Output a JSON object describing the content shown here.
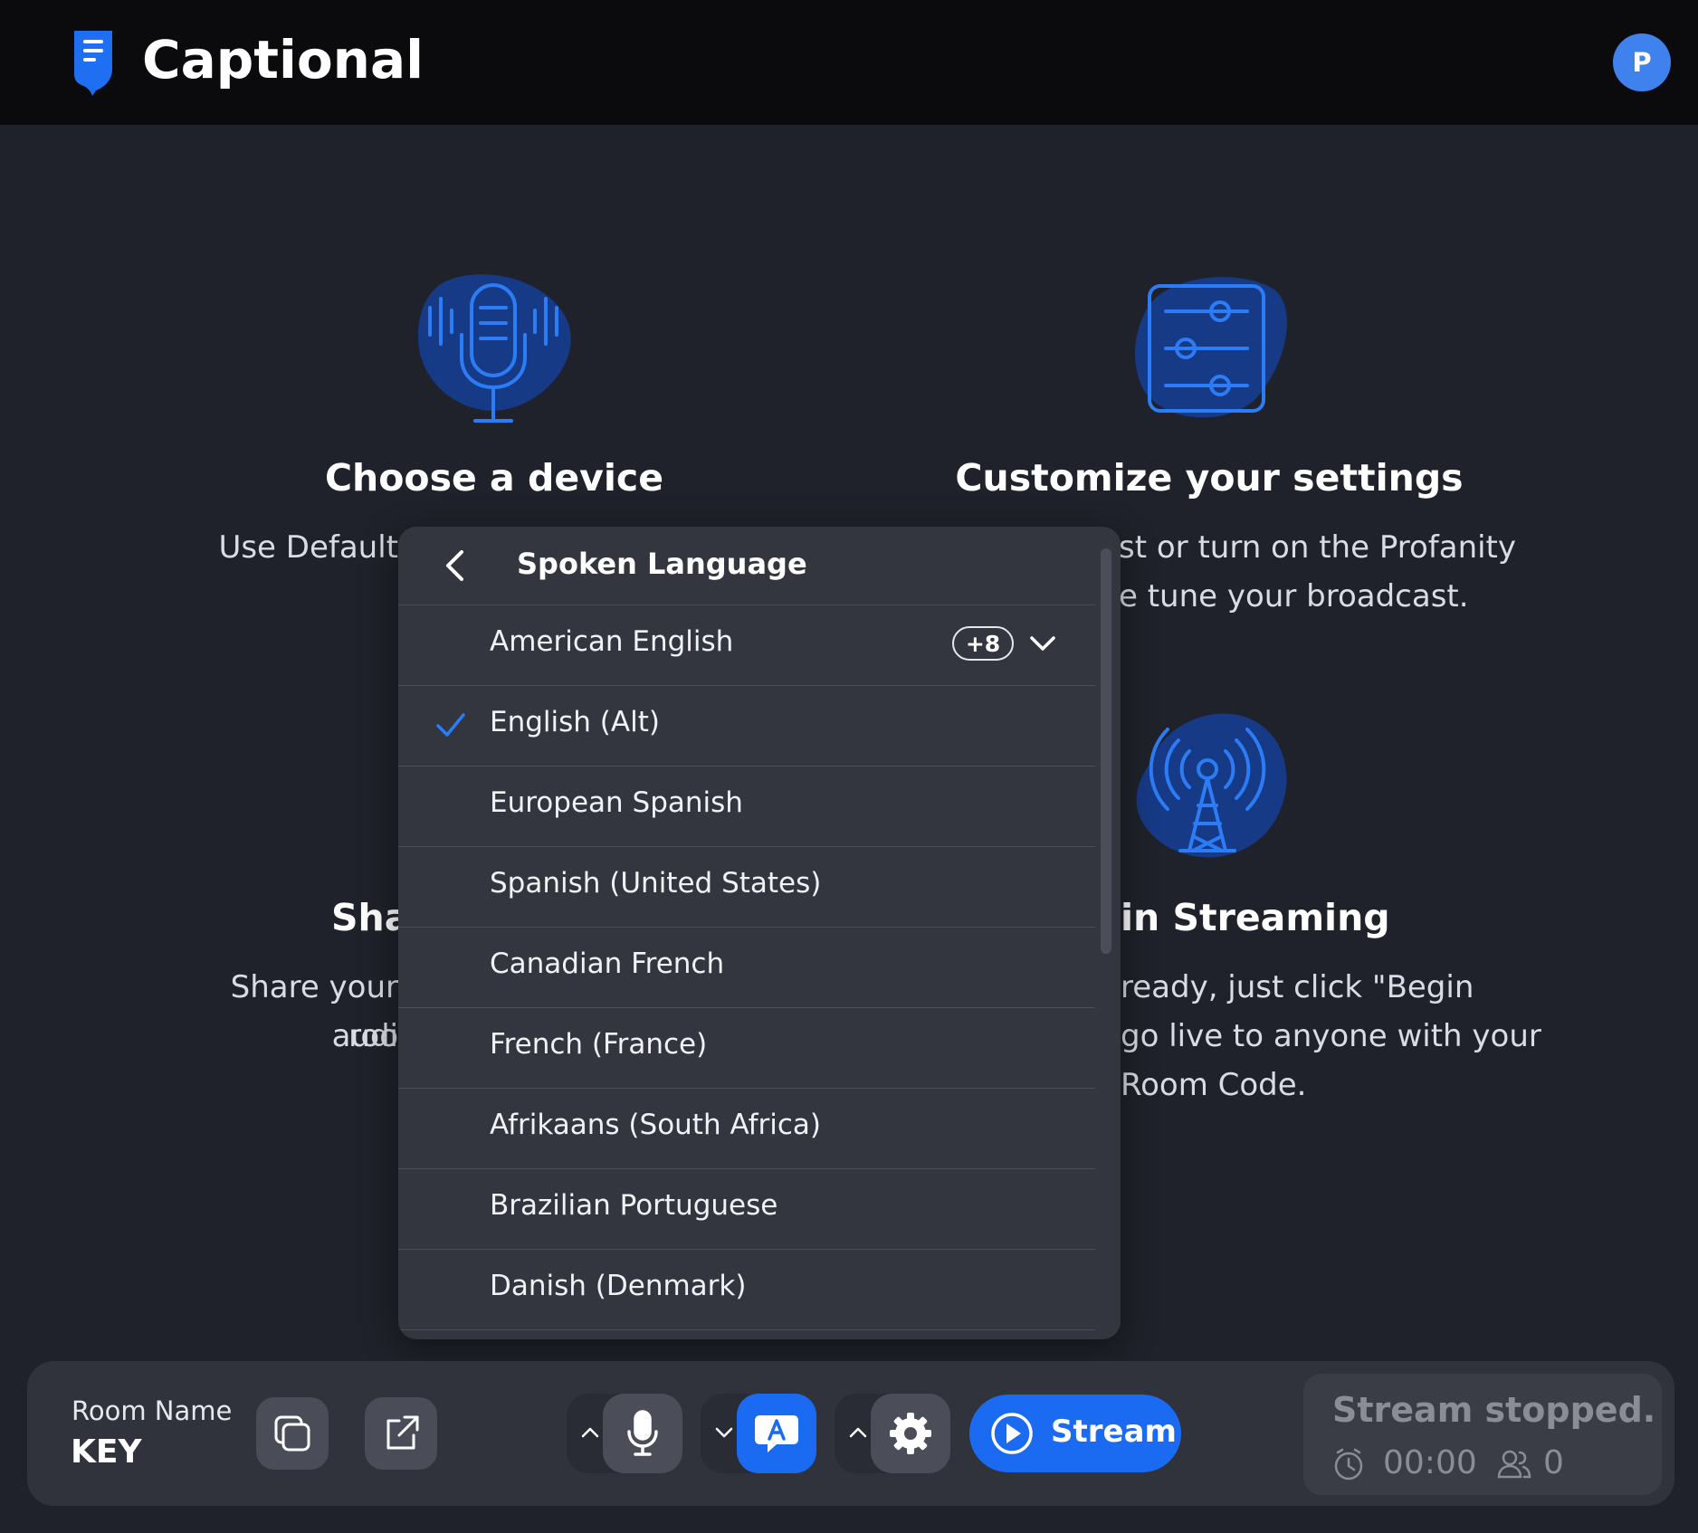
{
  "app": {
    "brand": "Captional",
    "avatar_initial": "P"
  },
  "cards": [
    {
      "title": "Choose a device",
      "desc": "Use Default"
    },
    {
      "title": "Customize your settings",
      "desc_line1": "st or turn on the Profanity",
      "desc_line2": "e tune your broadcast."
    },
    {
      "title": "Sha",
      "desc_line1": "Share your roo",
      "desc_line2": "audi"
    },
    {
      "title": "in Streaming",
      "desc_line1": "ready, just click \"Begin",
      "desc_line2": "go live to anyone with your",
      "desc_line3": "Room Code."
    }
  ],
  "dropdown": {
    "title": "Spoken Language",
    "items": [
      {
        "label": "American English",
        "badge": "+8"
      },
      {
        "label": "English (Alt)",
        "checked": true
      },
      {
        "label": "European Spanish"
      },
      {
        "label": "Spanish (United States)"
      },
      {
        "label": "Canadian French"
      },
      {
        "label": "French (France)"
      },
      {
        "label": "Afrikaans (South Africa)"
      },
      {
        "label": "Brazilian Portuguese"
      },
      {
        "label": "Danish (Denmark)"
      }
    ]
  },
  "bottom_bar": {
    "room_label": "Room Name",
    "room_key": "KEY",
    "stream_label": "Stream",
    "status": "Stream stopped.",
    "timer": "00:00",
    "viewers": "0"
  },
  "colors": {
    "accent": "#1a6af2",
    "avatar": "#3f82ee",
    "header_bg": "#0b0b0d",
    "page_bg": "#1f222a"
  },
  "icons": [
    "logo-icon",
    "microphone-illustration",
    "sliders-illustration",
    "broadcast-tower-illustration",
    "chevron-left-icon",
    "check-icon",
    "chevron-down-icon",
    "copy-icon",
    "external-link-icon",
    "chevron-up-icon",
    "microphone-icon",
    "caption-icon",
    "gear-icon",
    "play-circle-icon",
    "clock-icon",
    "users-icon"
  ]
}
